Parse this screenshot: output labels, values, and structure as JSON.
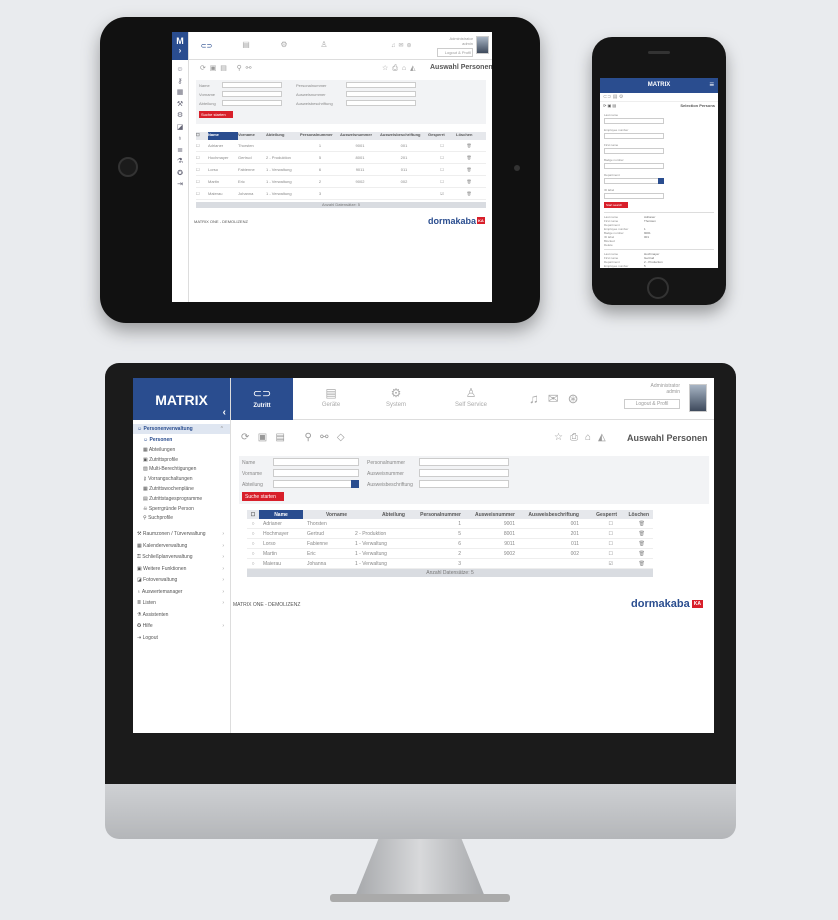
{
  "brand": "MATRIX",
  "brand_short": "M",
  "nav": {
    "zutritt": "Zutritt",
    "geraete": "Geräte",
    "system": "System",
    "selfservice": "Self Service"
  },
  "user": {
    "role": "Administrator",
    "name": "admin",
    "logout": "Logout & Profil"
  },
  "page_title": "Auswahl Personen",
  "sidebar": {
    "section": "Personenverwaltung",
    "items": [
      "Personen",
      "Abteilungen",
      "Zutrittsprofile",
      "Multi-Berechtigungen",
      "Vorrangschaltungen",
      "Zutrittswochenpläne",
      "Zutrittstagesprogramme",
      "Sperrgründe Person",
      "Suchprofile"
    ],
    "groups": [
      "Raumzonen / Türverwaltung",
      "Kalenderverwaltung",
      "Schließplanverwaltung",
      "Weitere Funktionen",
      "Fotoverwaltung",
      "Auswertemanager",
      "Listen",
      "Assistenten",
      "Hilfe",
      "Logout"
    ]
  },
  "search": {
    "name": "Name",
    "vorname": "Vorname",
    "abteilung": "Abteilung",
    "personalnummer": "Personalnummer",
    "ausweisnummer": "Ausweisnummer",
    "ausweisbeschriftung": "Ausweisbeschriftung",
    "button": "Suche starten"
  },
  "table": {
    "headers": [
      "Name",
      "Vorname",
      "Abteilung",
      "Personalnummer",
      "Ausweisnummer",
      "Ausweisbeschriftung",
      "Gesperrt",
      "Löschen"
    ],
    "rows": [
      [
        "Adrianer",
        "Thorsten",
        "",
        "1",
        "9001",
        "001"
      ],
      [
        "Hochmayer",
        "Gertrud",
        "2 - Produktion",
        "5",
        "8001",
        "201"
      ],
      [
        "Lorso",
        "Fabienne",
        "1 - Verwaltung",
        "6",
        "9011",
        "011"
      ],
      [
        "Martin",
        "Eric",
        "1 - Verwaltung",
        "2",
        "9002",
        "002"
      ],
      [
        "Maierau",
        "Johanna",
        "1 - Verwaltung",
        "3",
        "",
        ""
      ]
    ],
    "footer": "Anzahl Datensätze: 5"
  },
  "footer": {
    "left": "MATRIX ONE - DEMOLIZENZ",
    "logo": "dormakaba",
    "logo_badge": "KA"
  },
  "phone": {
    "title": "MATRIX",
    "page_title": "Selection Persons",
    "fields": [
      "Last name",
      "Employee number",
      "First name",
      "Badge number",
      "Department",
      "ID label"
    ],
    "button": "Start search",
    "result_labels": [
      "Last name",
      "First name",
      "Department",
      "Employee number",
      "Badge number",
      "ID label",
      "Blocked",
      "Delete"
    ],
    "result_values": [
      "Adrianer",
      "Thorsten",
      "",
      "1",
      "9001",
      "001",
      "",
      ""
    ],
    "result2_labels": [
      "Last name",
      "First name",
      "Department",
      "Employee number"
    ],
    "result2_values": [
      "Hochmayer",
      "Gertrud",
      "2 - Production",
      "5"
    ]
  }
}
